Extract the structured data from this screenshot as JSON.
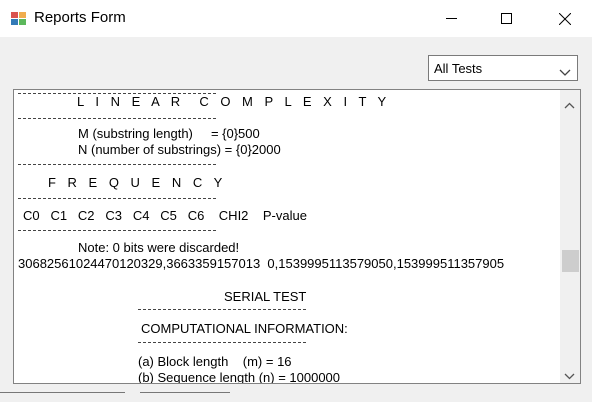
{
  "window": {
    "title": "Reports Form",
    "controls": {
      "minimize": "minimize-icon",
      "maximize": "maximize-icon",
      "close": "close-icon"
    }
  },
  "filter": {
    "selected": "All Tests"
  },
  "report": {
    "lines": [
      {
        "text": "L I N E A R  C O M P L E X I T Y"
      },
      {
        "text": "M (substring length)     = {0}500"
      },
      {
        "text": "N (number of substrings) = {0}2000"
      },
      {
        "text": "F R E Q U E N C Y"
      },
      {
        "text": "C0   C1   C2   C3   C4   C5   C6    CHI2    P-value"
      },
      {
        "text": "Note: 0 bits were discarded!"
      },
      {
        "text": "3068256102447012032​9,3663359157013  0,1539995113579050,153999511357905"
      },
      {
        "text": "SERIAL TEST"
      },
      {
        "text": "COMPUTATIONAL INFORMATION:"
      },
      {
        "text": "(a) Block length    (m) = 16"
      },
      {
        "text": "(b) Sequence length (n) = 1000000"
      }
    ]
  },
  "colors": {
    "window_bg": "#f0f0f0",
    "titlebar_bg": "#ffffff",
    "scroll_thumb": "#cdcdcd"
  }
}
